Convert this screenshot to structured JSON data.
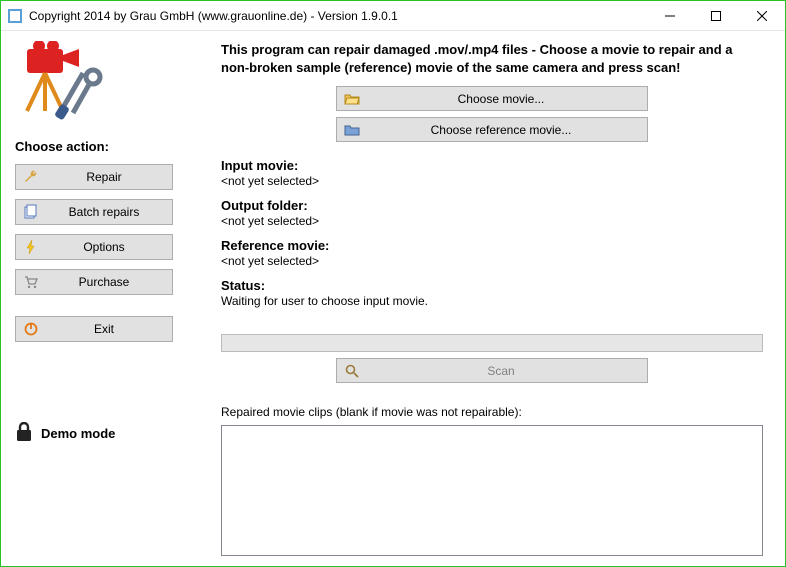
{
  "title": "Copyright 2014 by Grau GmbH (www.grauonline.de) - Version 1.9.0.1",
  "sidebar": {
    "heading": "Choose action:",
    "buttons": {
      "repair": "Repair",
      "batch": "Batch repairs",
      "options": "Options",
      "purchase": "Purchase",
      "exit": "Exit"
    },
    "demo_mode": "Demo mode"
  },
  "main": {
    "intro": "This program can repair damaged .mov/.mp4 files - Choose a movie to repair and a non-broken sample (reference) movie of the same camera and press scan!",
    "choose_movie": "Choose movie...",
    "choose_reference": "Choose reference movie...",
    "input_label": "Input movie:",
    "input_value": "<not yet selected>",
    "output_label": "Output folder:",
    "output_value": "<not yet selected>",
    "reference_label": "Reference movie:",
    "reference_value": "<not yet selected>",
    "status_label": "Status:",
    "status_value": "Waiting for user to choose input movie.",
    "scan": "Scan",
    "results_label": "Repaired movie clips (blank if movie was not repairable):"
  }
}
